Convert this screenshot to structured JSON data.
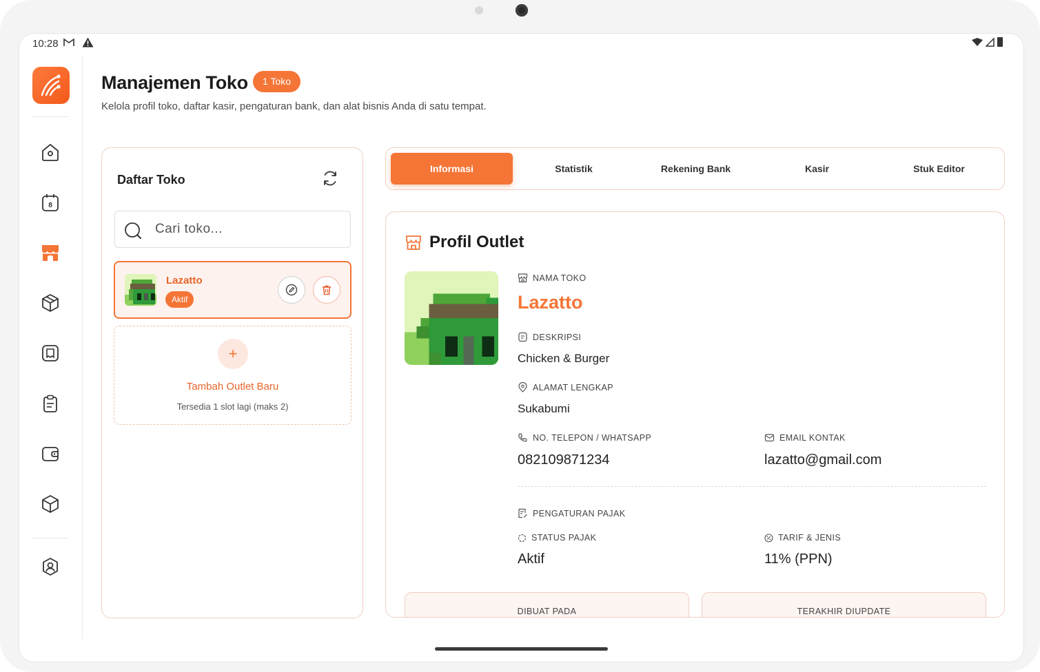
{
  "status_bar": {
    "time": "10:28",
    "icons": [
      "gmail-icon",
      "alert-icon",
      "wifi-icon",
      "cell-signal-icon",
      "battery-icon"
    ]
  },
  "sidebar": {
    "items": [
      {
        "name": "home",
        "icon": "home-icon",
        "active": false
      },
      {
        "name": "calendar",
        "icon": "calendar-icon",
        "badge": "8",
        "active": false
      },
      {
        "name": "store",
        "icon": "store-icon",
        "active": true
      },
      {
        "name": "products",
        "icon": "box-icon",
        "active": false
      },
      {
        "name": "receipts",
        "icon": "receipt-icon",
        "active": false
      },
      {
        "name": "reports",
        "icon": "clipboard-icon",
        "active": false
      },
      {
        "name": "wallet",
        "icon": "wallet-icon",
        "active": false
      },
      {
        "name": "inventory",
        "icon": "package-icon",
        "active": false
      },
      {
        "name": "profile",
        "icon": "user-icon",
        "active": false
      }
    ]
  },
  "header": {
    "title": "Manajemen Toko",
    "badge": "1 Toko",
    "subtitle": "Kelola profil toko, daftar kasir, pengaturan bank, dan alat bisnis Anda di satu tempat."
  },
  "store_list": {
    "title": "Daftar Toko",
    "search_placeholder": "Cari toko...",
    "stores": [
      {
        "name": "Lazatto",
        "status": "Aktif"
      }
    ],
    "add_title": "Tambah Outlet Baru",
    "add_subtitle": "Tersedia 1 slot lagi (maks 2)"
  },
  "tabs": [
    {
      "label": "Informasi",
      "active": true
    },
    {
      "label": "Statistik",
      "active": false
    },
    {
      "label": "Rekening Bank",
      "active": false
    },
    {
      "label": "Kasir",
      "active": false
    },
    {
      "label": "Stuk Editor",
      "active": false
    }
  ],
  "profile": {
    "heading": "Profil Outlet",
    "store_name_label": "NAMA TOKO",
    "store_name": "Lazatto",
    "description_label": "DESKRIPSI",
    "description": "Chicken & Burger",
    "address_label": "ALAMAT LENGKAP",
    "address": "Sukabumi",
    "phone_label": "NO. TELEPON / WHATSAPP",
    "phone": "082109871234",
    "email_label": "EMAIL KONTAK",
    "email": "lazatto@gmail.com",
    "tax_section_label": "PENGATURAN PAJAK",
    "tax_status_label": "STATUS PAJAK",
    "tax_status": "Aktif",
    "tax_rate_label": "TARIF & JENIS",
    "tax_rate": "11% (PPN)",
    "created_label": "DIBUAT PADA",
    "updated_label": "TERAKHIR DIUPDATE"
  },
  "colors": {
    "accent": "#f47536",
    "accent_light": "#fdf2ee",
    "border_soft": "#f0cfc2"
  }
}
